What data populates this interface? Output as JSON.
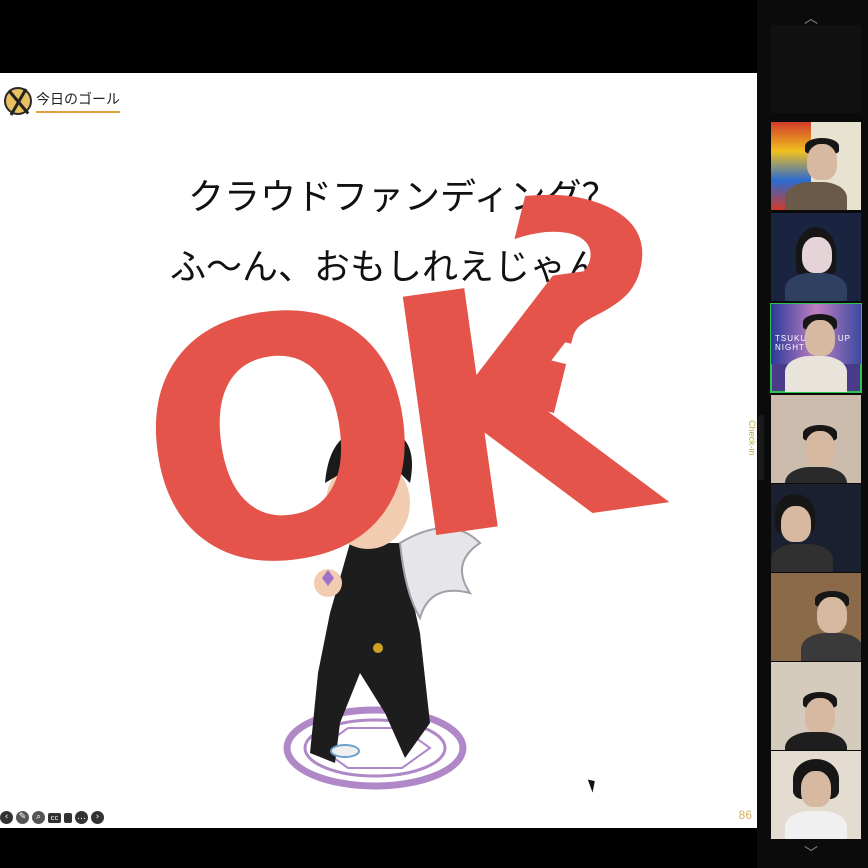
{
  "slide": {
    "header_title": "今日のゴール",
    "line1": "クラウドファンディング？",
    "line2": "ふ〜ん、おもしれえじゃん",
    "overlay_ok": "OK",
    "overlay_question": "?",
    "page_number": "86",
    "toolbar_icons": [
      "prev-icon",
      "pen-icon",
      "zoom-icon",
      "cc-icon",
      "film-icon",
      "more-icon",
      "next-icon"
    ]
  },
  "sidebar": {
    "checkin_label": "Check-in",
    "tile_banner": "TSUKUBA ST   UP NIGHT",
    "tile_count": 8
  },
  "colors": {
    "ok_red": "#e4544a",
    "speaking_border": "#2fc24f"
  }
}
